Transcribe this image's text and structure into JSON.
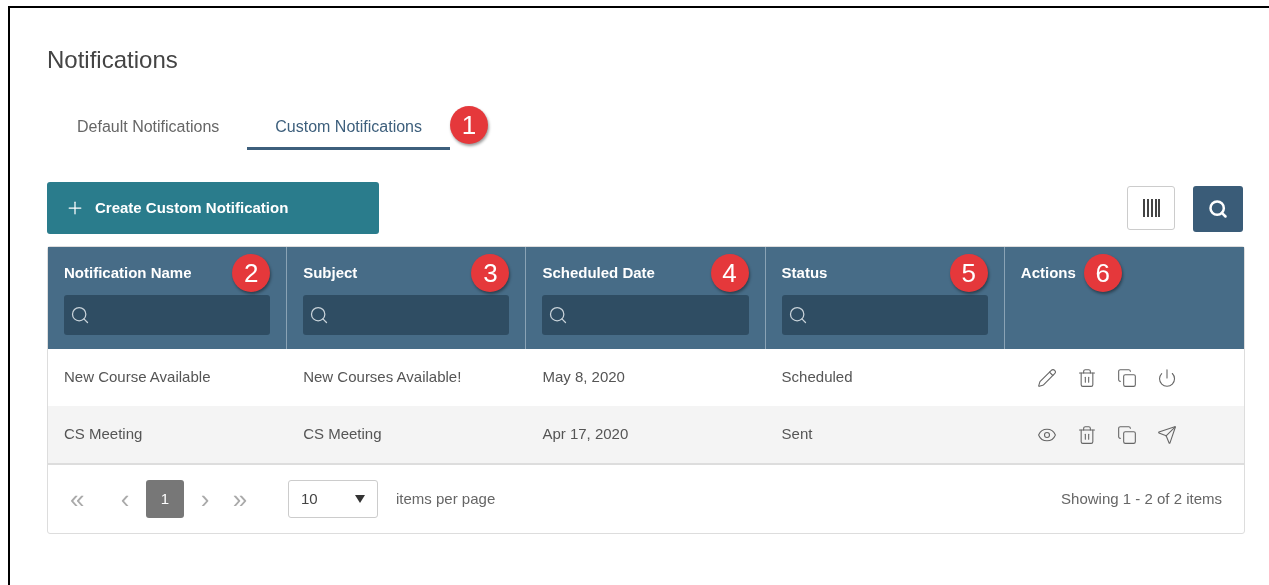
{
  "title": "Notifications",
  "tabs": [
    {
      "label": "Default Notifications",
      "selected": false
    },
    {
      "label": "Custom Notifications",
      "selected": true,
      "callout": "1"
    }
  ],
  "create_button": {
    "label": "Create Custom Notification"
  },
  "table": {
    "columns": [
      {
        "label": "Notification Name",
        "filter": true,
        "callout": "2"
      },
      {
        "label": "Subject",
        "filter": true,
        "callout": "3"
      },
      {
        "label": "Scheduled Date",
        "filter": true,
        "callout": "4"
      },
      {
        "label": "Status",
        "filter": true,
        "callout": "5"
      },
      {
        "label": "Actions",
        "filter": false,
        "callout": "6"
      }
    ],
    "rows": [
      {
        "cells": [
          "New Course Available",
          "New Courses Available!",
          "May 8, 2020",
          "Scheduled"
        ],
        "actions": [
          {
            "kind": "edit"
          },
          {
            "kind": "delete"
          },
          {
            "kind": "copy"
          },
          {
            "kind": "power"
          }
        ]
      },
      {
        "cells": [
          "CS Meeting",
          "CS Meeting",
          "Apr 17, 2020",
          "Sent"
        ],
        "actions": [
          {
            "kind": "view"
          },
          {
            "kind": "delete"
          },
          {
            "kind": "copy"
          },
          {
            "kind": "send"
          }
        ]
      }
    ]
  },
  "pager": {
    "first": "«",
    "prev": "‹",
    "pages": [
      {
        "label": "1",
        "selected": true
      }
    ],
    "next": "›",
    "last": "»",
    "page_size": "10",
    "page_size_label": "items per page",
    "summary": "Showing 1 - 2 of 2 items"
  }
}
